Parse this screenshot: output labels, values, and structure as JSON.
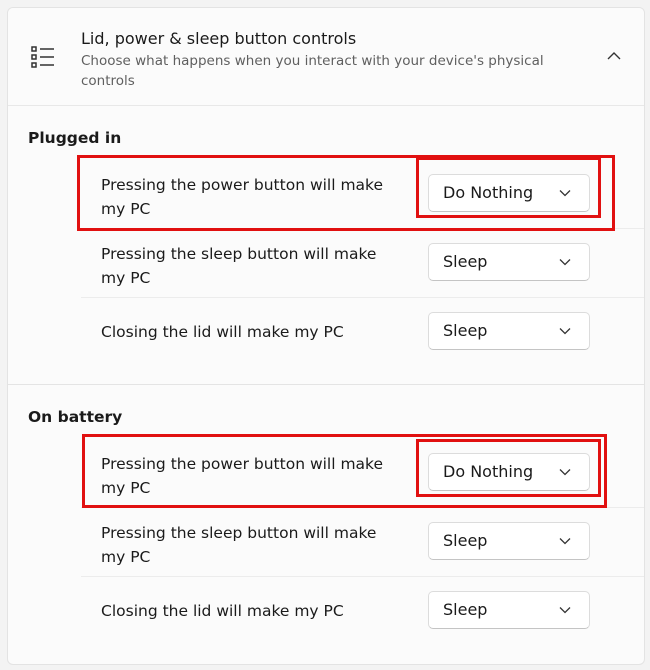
{
  "header": {
    "title": "Lid, power & sleep button controls",
    "subtitle": "Choose what happens when you interact with your device's physical controls",
    "icon": "list-settings-icon",
    "expand_icon": "chevron-up-icon"
  },
  "sections": [
    {
      "title": "Plugged in",
      "rows": [
        {
          "label": "Pressing the power button will make my PC",
          "value": "Do Nothing"
        },
        {
          "label": "Pressing the sleep button will make my PC",
          "value": "Sleep"
        },
        {
          "label": "Closing the lid will make my PC",
          "value": "Sleep"
        }
      ]
    },
    {
      "title": "On battery",
      "rows": [
        {
          "label": "Pressing the power button will make my PC",
          "value": "Do Nothing"
        },
        {
          "label": "Pressing the sleep button will make my PC",
          "value": "Sleep"
        },
        {
          "label": "Closing the lid will make my PC",
          "value": "Sleep"
        }
      ]
    }
  ],
  "colors": {
    "highlight": "#e11010",
    "card_background": "#fbfbfb",
    "page_background": "#f3f3f3"
  }
}
